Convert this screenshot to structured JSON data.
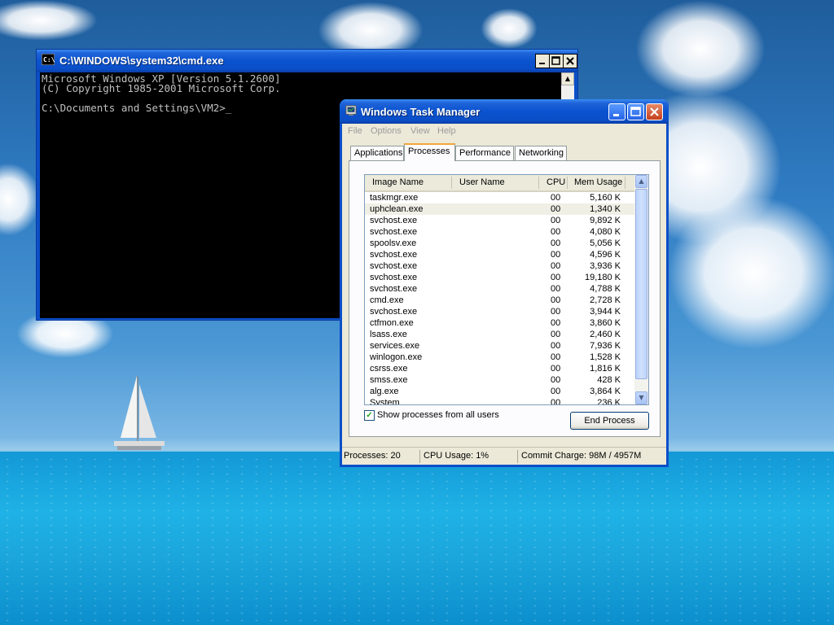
{
  "cmd": {
    "title": "C:\\WINDOWS\\system32\\cmd.exe",
    "lines": "Microsoft Windows XP [Version 5.1.2600]\n(C) Copyright 1985-2001 Microsoft Corp.\n\nC:\\Documents and Settings\\VM2>_"
  },
  "taskmgr": {
    "title": "Windows Task Manager",
    "menu": [
      "File",
      "Options",
      "View",
      "Help"
    ],
    "tabs": [
      "Applications",
      "Processes",
      "Performance",
      "Networking"
    ],
    "active_tab": "Processes",
    "columns": [
      "Image Name",
      "User Name",
      "CPU",
      "Mem Usage"
    ],
    "processes": [
      {
        "name": "taskmgr.exe",
        "cpu": "00",
        "mem": "5,160 K"
      },
      {
        "name": "uphclean.exe",
        "cpu": "00",
        "mem": "1,340 K"
      },
      {
        "name": "svchost.exe",
        "cpu": "00",
        "mem": "9,892 K"
      },
      {
        "name": "svchost.exe",
        "cpu": "00",
        "mem": "4,080 K"
      },
      {
        "name": "spoolsv.exe",
        "cpu": "00",
        "mem": "5,056 K"
      },
      {
        "name": "svchost.exe",
        "cpu": "00",
        "mem": "4,596 K"
      },
      {
        "name": "svchost.exe",
        "cpu": "00",
        "mem": "3,936 K"
      },
      {
        "name": "svchost.exe",
        "cpu": "00",
        "mem": "19,180 K"
      },
      {
        "name": "svchost.exe",
        "cpu": "00",
        "mem": "4,788 K"
      },
      {
        "name": "cmd.exe",
        "cpu": "00",
        "mem": "2,728 K"
      },
      {
        "name": "svchost.exe",
        "cpu": "00",
        "mem": "3,944 K"
      },
      {
        "name": "ctfmon.exe",
        "cpu": "00",
        "mem": "3,860 K"
      },
      {
        "name": "lsass.exe",
        "cpu": "00",
        "mem": "2,460 K"
      },
      {
        "name": "services.exe",
        "cpu": "00",
        "mem": "7,936 K"
      },
      {
        "name": "winlogon.exe",
        "cpu": "00",
        "mem": "1,528 K"
      },
      {
        "name": "csrss.exe",
        "cpu": "00",
        "mem": "1,816 K"
      },
      {
        "name": "smss.exe",
        "cpu": "00",
        "mem": "428 K"
      },
      {
        "name": "alg.exe",
        "cpu": "00",
        "mem": "3,864 K"
      },
      {
        "name": "System",
        "cpu": "00",
        "mem": "236 K"
      }
    ],
    "selected_process": "uphclean.exe",
    "show_all_label": "Show processes from all users",
    "show_all_checked": true,
    "end_process_label": "End Process",
    "status": {
      "processes": "Processes: 20",
      "cpu": "CPU Usage: 1%",
      "commit": "Commit Charge: 98M / 4957M"
    }
  },
  "icons": {
    "cmd": "console-icon",
    "taskmgr": "task-manager-icon",
    "minimize": "minimize-icon",
    "maximize": "maximize-icon",
    "close": "close-icon",
    "scroll_up": "arrow-up-icon",
    "scroll_down": "arrow-down-icon",
    "check": "checkmark-icon"
  }
}
